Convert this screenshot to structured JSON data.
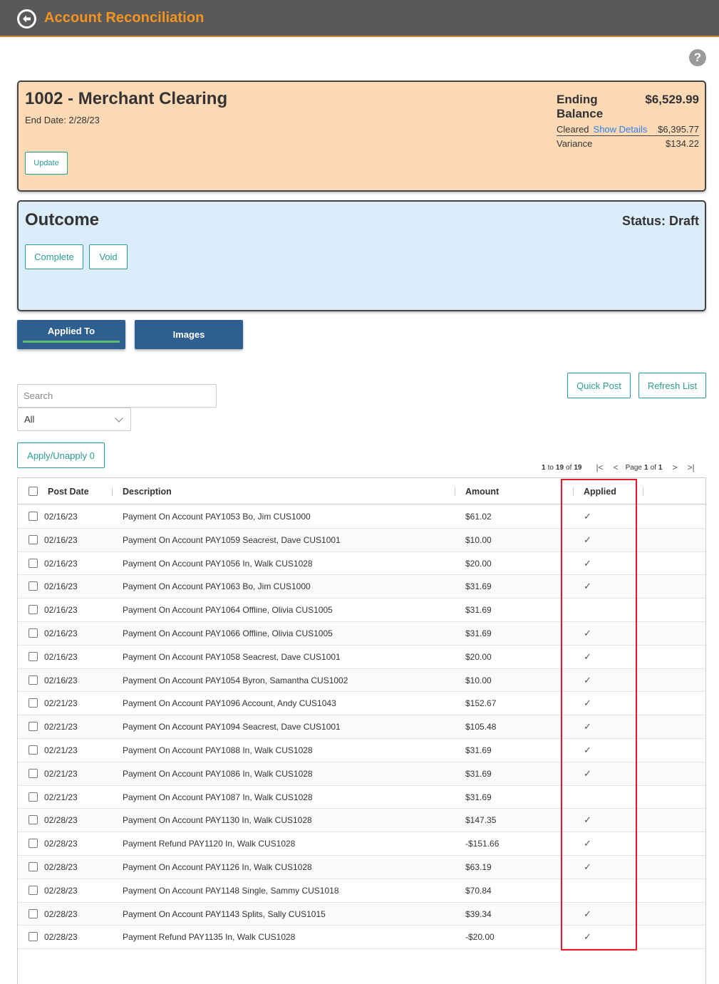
{
  "header": {
    "title": "Account Reconciliation",
    "back_icon": "back-arrow-icon"
  },
  "help_icon": "?",
  "account": {
    "name": "1002 - Merchant Clearing",
    "end_date": "End Date: 2/28/23",
    "update_label": "Update",
    "ending_balance_label": "Ending Balance",
    "ending_balance": "$6,529.99",
    "cleared_label": "Cleared",
    "show_details_label": "Show Details",
    "cleared_value": "$6,395.77",
    "variance_label": "Variance",
    "variance_value": "$134.22"
  },
  "outcome": {
    "title": "Outcome",
    "status": "Status: Draft",
    "complete_label": "Complete",
    "void_label": "Void"
  },
  "tabs": {
    "applied_to": "Applied To",
    "images": "Images"
  },
  "actions": {
    "quick_post": "Quick Post",
    "refresh_list": "Refresh List",
    "apply_unapply": "Apply/Unapply 0"
  },
  "search": {
    "placeholder": "Search"
  },
  "filter": {
    "selected": "All"
  },
  "pager": {
    "from": "1",
    "to_word": "to",
    "to": "19",
    "of_word": "of",
    "total": "19",
    "page_word": "Page",
    "page": "1",
    "pages": "1"
  },
  "columns": {
    "post_date": "Post Date",
    "description": "Description",
    "amount": "Amount",
    "applied": "Applied"
  },
  "rows": [
    {
      "date": "02/16/23",
      "description": "Payment On Account PAY1053 Bo, Jim CUS1000",
      "amount": "$61.02",
      "applied": "✓"
    },
    {
      "date": "02/16/23",
      "description": "Payment On Account PAY1059 Seacrest, Dave CUS1001",
      "amount": "$10.00",
      "applied": "✓"
    },
    {
      "date": "02/16/23",
      "description": "Payment On Account PAY1056 In, Walk CUS1028",
      "amount": "$20.00",
      "applied": "✓"
    },
    {
      "date": "02/16/23",
      "description": "Payment On Account PAY1063 Bo, Jim CUS1000",
      "amount": "$31.69",
      "applied": "✓"
    },
    {
      "date": "02/16/23",
      "description": "Payment On Account PAY1064 Offline, Olivia CUS1005",
      "amount": "$31.69",
      "applied": ""
    },
    {
      "date": "02/16/23",
      "description": "Payment On Account PAY1066 Offline, Olivia CUS1005",
      "amount": "$31.69",
      "applied": "✓"
    },
    {
      "date": "02/16/23",
      "description": "Payment On Account PAY1058 Seacrest, Dave CUS1001",
      "amount": "$20.00",
      "applied": "✓"
    },
    {
      "date": "02/16/23",
      "description": "Payment On Account PAY1054 Byron, Samantha CUS1002",
      "amount": "$10.00",
      "applied": "✓"
    },
    {
      "date": "02/21/23",
      "description": "Payment On Account PAY1096 Account, Andy CUS1043",
      "amount": "$152.67",
      "applied": "✓"
    },
    {
      "date": "02/21/23",
      "description": "Payment On Account PAY1094 Seacrest, Dave CUS1001",
      "amount": "$105.48",
      "applied": "✓"
    },
    {
      "date": "02/21/23",
      "description": "Payment On Account PAY1088 In, Walk CUS1028",
      "amount": "$31.69",
      "applied": "✓"
    },
    {
      "date": "02/21/23",
      "description": "Payment On Account PAY1086 In, Walk CUS1028",
      "amount": "$31.69",
      "applied": "✓"
    },
    {
      "date": "02/21/23",
      "description": "Payment On Account PAY1087 In, Walk CUS1028",
      "amount": "$31.69",
      "applied": ""
    },
    {
      "date": "02/28/23",
      "description": "Payment On Account PAY1130 In, Walk CUS1028",
      "amount": "$147.35",
      "applied": "✓"
    },
    {
      "date": "02/28/23",
      "description": "Payment Refund PAY1120 In, Walk CUS1028",
      "amount": "-$151.66",
      "applied": "✓"
    },
    {
      "date": "02/28/23",
      "description": "Payment On Account PAY1126 In, Walk CUS1028",
      "amount": "$63.19",
      "applied": "✓"
    },
    {
      "date": "02/28/23",
      "description": "Payment On Account PAY1148 Single, Sammy CUS1018",
      "amount": "$70.84",
      "applied": ""
    },
    {
      "date": "02/28/23",
      "description": "Payment On Account PAY1143 Splits, Sally CUS1015",
      "amount": "$39.34",
      "applied": "✓"
    },
    {
      "date": "02/28/23",
      "description": "Payment Refund PAY1135 In, Walk CUS1028",
      "amount": "-$20.00",
      "applied": "✓"
    }
  ],
  "colors": {
    "header_bg": "#58595b",
    "title_orange": "#f7941d",
    "account_bg": "#fdd9b5",
    "outcome_bg": "#dbecfb",
    "tab_blue": "#2e5f8f",
    "teal": "#2a9d8f",
    "highlight_red": "#e8192c"
  }
}
